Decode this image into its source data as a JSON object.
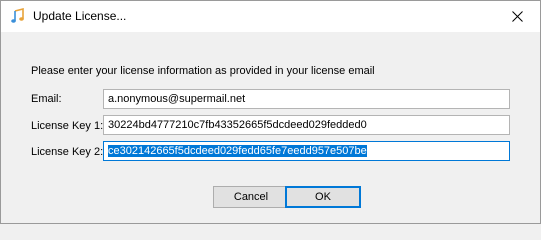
{
  "window": {
    "title": "Update License..."
  },
  "form": {
    "prompt": "Please enter your license information as provided in your license email",
    "email_label": "Email:",
    "email_value": "a.nonymous@supermail.net",
    "key1_label": "License Key 1:",
    "key1_value": "30224bd4777210c7fb43352665f5dcdeed029fedded0",
    "key2_label": "License Key 2:",
    "key2_value": "ce302142665f5dcdeed029fedd65fe7eedd957e507be"
  },
  "buttons": {
    "cancel_label": "Cancel",
    "ok_label": "OK"
  },
  "icons": {
    "app": "music-note-icon",
    "close": "close-icon"
  },
  "colors": {
    "accent": "#0078d7",
    "selection_text": "#ffffff"
  }
}
